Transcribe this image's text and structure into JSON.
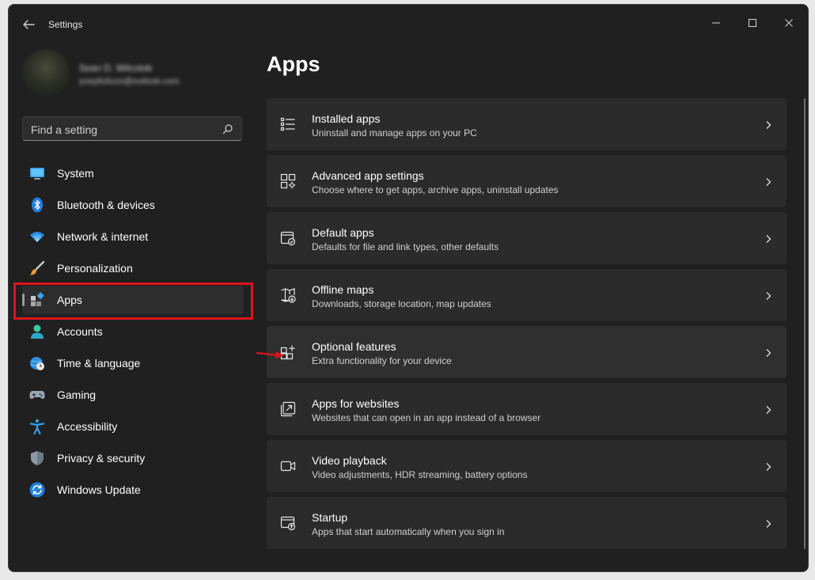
{
  "window": {
    "title": "Settings"
  },
  "profile": {
    "name": "Sean D. Wilcolob",
    "email": "yoeyliolizzo@outlook.com"
  },
  "search": {
    "placeholder": "Find a setting"
  },
  "nav": [
    {
      "label": "System",
      "icon": "monitor-icon"
    },
    {
      "label": "Bluetooth & devices",
      "icon": "bluetooth-icon"
    },
    {
      "label": "Network & internet",
      "icon": "wifi-icon"
    },
    {
      "label": "Personalization",
      "icon": "brush-icon"
    },
    {
      "label": "Apps",
      "icon": "apps-icon",
      "active": true
    },
    {
      "label": "Accounts",
      "icon": "person-icon"
    },
    {
      "label": "Time & language",
      "icon": "globe-clock-icon"
    },
    {
      "label": "Gaming",
      "icon": "gamepad-icon"
    },
    {
      "label": "Accessibility",
      "icon": "accessibility-icon"
    },
    {
      "label": "Privacy & security",
      "icon": "shield-icon"
    },
    {
      "label": "Windows Update",
      "icon": "update-icon"
    }
  ],
  "page": {
    "title": "Apps"
  },
  "cards": [
    {
      "title": "Installed apps",
      "subtitle": "Uninstall and manage apps on your PC",
      "icon": "list-icon"
    },
    {
      "title": "Advanced app settings",
      "subtitle": "Choose where to get apps, archive apps, uninstall updates",
      "icon": "app-settings-icon"
    },
    {
      "title": "Default apps",
      "subtitle": "Defaults for file and link types, other defaults",
      "icon": "default-apps-icon"
    },
    {
      "title": "Offline maps",
      "subtitle": "Downloads, storage location, map updates",
      "icon": "map-download-icon"
    },
    {
      "title": "Optional features",
      "subtitle": "Extra functionality for your device",
      "icon": "optional-features-icon"
    },
    {
      "title": "Apps for websites",
      "subtitle": "Websites that can open in an app instead of a browser",
      "icon": "open-in-app-icon"
    },
    {
      "title": "Video playback",
      "subtitle": "Video adjustments, HDR streaming, battery options",
      "icon": "video-icon"
    },
    {
      "title": "Startup",
      "subtitle": "Apps that start automatically when you sign in",
      "icon": "startup-icon"
    }
  ],
  "colors": {
    "annotation_red": "#e0131b",
    "background": "#202020",
    "card": "#2b2b2b"
  }
}
